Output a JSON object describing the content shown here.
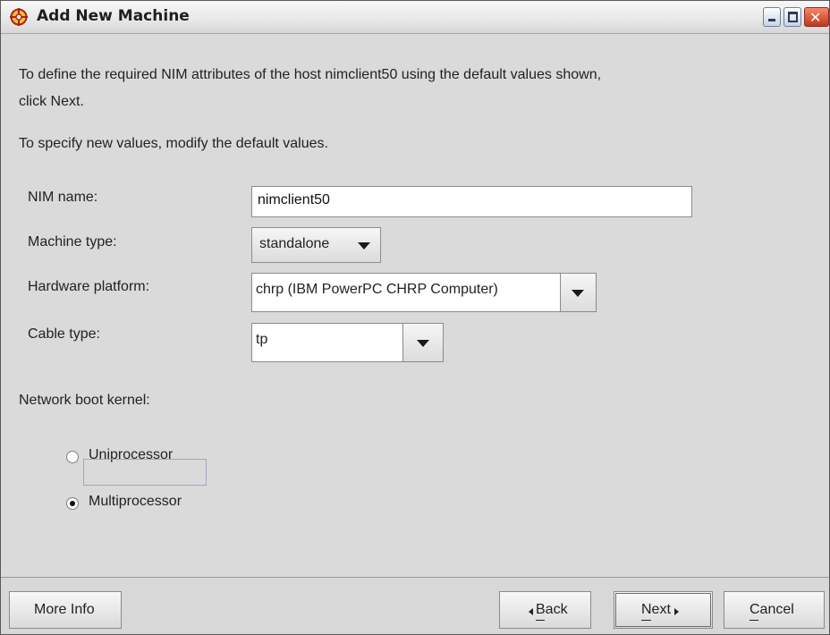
{
  "window": {
    "title": "Add New Machine",
    "icon": "nim-machine-icon",
    "controls": [
      "minimize-icon",
      "maximize-icon",
      "close-icon"
    ]
  },
  "intro": {
    "line1": "To define the required NIM attributes of the host nimclient50 using the default values shown,",
    "line2": "click Next.",
    "line3": "To specify new values, modify the default values."
  },
  "form": {
    "nim_name": {
      "label": "NIM name:",
      "value": "nimclient50"
    },
    "machine_type": {
      "label": "Machine type:",
      "value": "standalone"
    },
    "hardware_platform": {
      "label": "Hardware platform:",
      "value": "chrp (IBM PowerPC CHRP Computer)"
    },
    "cable_type": {
      "label": "Cable type:",
      "value": "tp"
    }
  },
  "boot_kernel": {
    "label": "Network boot kernel:",
    "options": [
      {
        "label": "Uniprocessor",
        "checked": false
      },
      {
        "label": "Multiprocessor",
        "checked": true
      }
    ]
  },
  "buttons": {
    "more_info": "More Info",
    "back": "Back",
    "next": "Next",
    "cancel": "Cancel"
  },
  "colors": {
    "background": "#dadada",
    "close_button": "#c1361a",
    "window_button": "#c7d3e6"
  }
}
